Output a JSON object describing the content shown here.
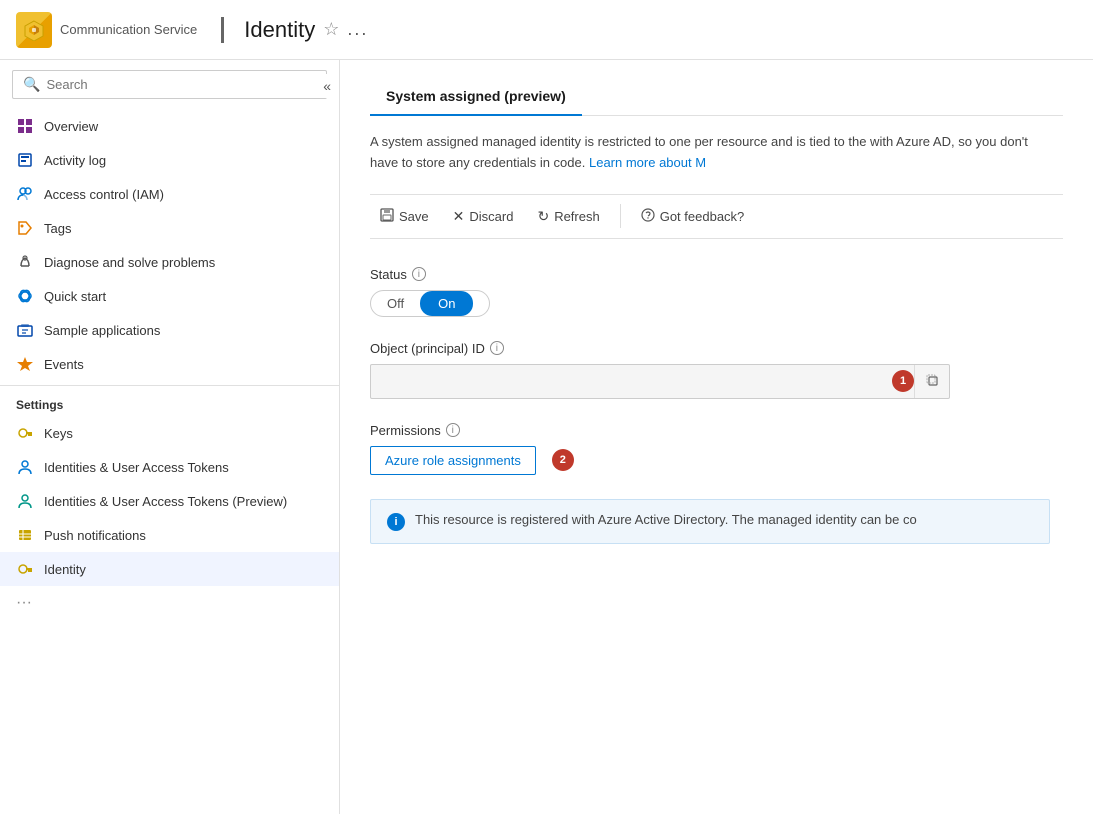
{
  "topBar": {
    "logoIcon": "🔑",
    "serviceTitle": "Communication Service",
    "pageTitle": "Identity",
    "starIcon": "☆",
    "ellipsisIcon": "..."
  },
  "sidebar": {
    "searchPlaceholder": "Search",
    "collapseIcon": "«",
    "navItems": [
      {
        "id": "overview",
        "label": "Overview",
        "icon": "⊞",
        "iconClass": "icon-purple"
      },
      {
        "id": "activity-log",
        "label": "Activity log",
        "icon": "▣",
        "iconClass": "icon-blue-dark"
      },
      {
        "id": "access-control",
        "label": "Access control (IAM)",
        "icon": "👥",
        "iconClass": "icon-blue"
      },
      {
        "id": "tags",
        "label": "Tags",
        "icon": "🏷",
        "iconClass": "icon-orange"
      },
      {
        "id": "diagnose",
        "label": "Diagnose and solve problems",
        "icon": "🔧",
        "iconClass": ""
      },
      {
        "id": "quick-start",
        "label": "Quick start",
        "icon": "☁",
        "iconClass": "icon-blue"
      },
      {
        "id": "sample-apps",
        "label": "Sample applications",
        "icon": "▦",
        "iconClass": "icon-blue-dark"
      },
      {
        "id": "events",
        "label": "Events",
        "icon": "⚡",
        "iconClass": "icon-lightning"
      }
    ],
    "settingsLabel": "Settings",
    "settingsItems": [
      {
        "id": "keys",
        "label": "Keys",
        "icon": "🔑",
        "iconClass": "icon-yellow"
      },
      {
        "id": "identities-tokens",
        "label": "Identities & User Access Tokens",
        "icon": "👤",
        "iconClass": "icon-blue"
      },
      {
        "id": "identities-tokens-preview",
        "label": "Identities & User Access Tokens (Preview)",
        "icon": "👤",
        "iconClass": "icon-teal"
      },
      {
        "id": "push-notifications",
        "label": "Push notifications",
        "icon": "≡",
        "iconClass": "icon-yellow"
      },
      {
        "id": "identity",
        "label": "Identity",
        "icon": "🔑",
        "iconClass": "icon-yellow",
        "active": true
      }
    ]
  },
  "content": {
    "tabs": [
      {
        "id": "system-assigned",
        "label": "System assigned (preview)",
        "active": true
      }
    ],
    "description": "A system assigned managed identity is restricted to one per resource and is tied to the with Azure AD, so you don't have to store any credentials in code.",
    "descriptionLink": "Learn more about M",
    "toolbar": {
      "saveLabel": "Save",
      "discardLabel": "Discard",
      "refreshLabel": "Refresh",
      "feedbackLabel": "Got feedback?"
    },
    "statusSection": {
      "label": "Status",
      "toggleOff": "Off",
      "toggleOn": "On",
      "currentState": "on"
    },
    "objectIdSection": {
      "label": "Object (principal) ID",
      "value": "",
      "placeholder": "",
      "stepBadge": "1"
    },
    "permissionsSection": {
      "label": "Permissions",
      "roleButtonLabel": "Azure role assignments",
      "stepBadge": "2"
    },
    "infoBanner": {
      "text": "This resource is registered with Azure Active Directory. The managed identity can be co"
    }
  }
}
